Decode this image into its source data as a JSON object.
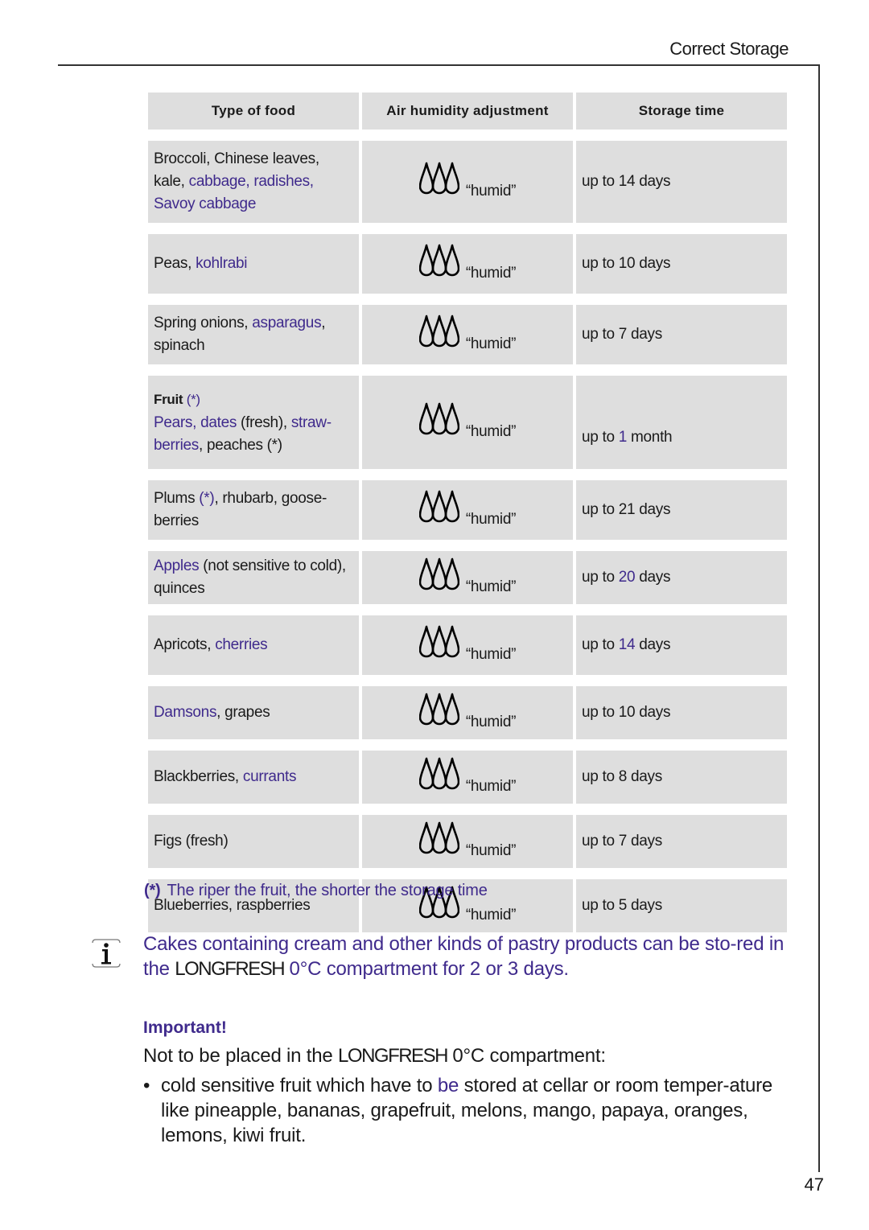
{
  "header": {
    "title": "Correct Storage"
  },
  "table": {
    "headers": [
      "Type of food",
      "Air humidity adjustment",
      "Storage time"
    ],
    "humidity_icon": "three-drops-icon",
    "rows": [
      {
        "food_parts": [
          {
            "text": "Broccoli, Chinese leaves,",
            "color": "black"
          },
          {
            "text": " kale, ",
            "color": "black"
          },
          {
            "text": "cabbage, radishes,",
            "color": "purple"
          },
          {
            "text": " Savoy cabbage",
            "color": "purple"
          }
        ],
        "humidity": "“humid”",
        "time_parts": [
          {
            "text": "up to 14 days",
            "color": "black"
          }
        ]
      },
      {
        "food_parts": [
          {
            "text": "Peas, ",
            "color": "black"
          },
          {
            "text": "kohlrabi",
            "color": "purple"
          }
        ],
        "humidity": "“humid”",
        "time_parts": [
          {
            "text": "up to 10 days",
            "color": "black"
          }
        ]
      },
      {
        "food_parts": [
          {
            "text": "Spring onions, ",
            "color": "black"
          },
          {
            "text": "asparagus",
            "color": "purple"
          },
          {
            "text": ", spinach",
            "color": "black"
          }
        ],
        "humidity": "“humid”",
        "time_parts": [
          {
            "text": "up to 7 days",
            "color": "black"
          }
        ]
      },
      {
        "title": "Fruit",
        "title_note": "(*)",
        "food_parts": [
          {
            "text": "Pears, dates",
            "color": "purple"
          },
          {
            "text": " (fresh), ",
            "color": "black"
          },
          {
            "text": "straw-berries",
            "color": "purple"
          },
          {
            "text": ", peaches (*)",
            "color": "black"
          }
        ],
        "humidity": "“humid”",
        "time_parts": [
          {
            "text": "up to ",
            "color": "black"
          },
          {
            "text": "1",
            "color": "purple"
          },
          {
            "text": " month",
            "color": "black"
          }
        ]
      },
      {
        "food_parts": [
          {
            "text": "Plums ",
            "color": "black"
          },
          {
            "text": "(*)",
            "color": "purple"
          },
          {
            "text": ", rhubarb, goose-berries",
            "color": "black"
          }
        ],
        "humidity": "“humid”",
        "time_parts": [
          {
            "text": "up to 21 days",
            "color": "black"
          }
        ]
      },
      {
        "food_parts": [
          {
            "text": "Apples",
            "color": "purple"
          },
          {
            "text": " (not sensitive to cold), quinces",
            "color": "black"
          }
        ],
        "humidity": "“humid”",
        "time_parts": [
          {
            "text": "up to ",
            "color": "black"
          },
          {
            "text": "20",
            "color": "purple"
          },
          {
            "text": " days",
            "color": "black"
          }
        ]
      },
      {
        "food_parts": [
          {
            "text": "Apricots, ",
            "color": "black"
          },
          {
            "text": "cherries",
            "color": "purple"
          }
        ],
        "humidity": "“humid”",
        "time_parts": [
          {
            "text": "up to ",
            "color": "black"
          },
          {
            "text": "14",
            "color": "purple"
          },
          {
            "text": " days",
            "color": "black"
          }
        ]
      },
      {
        "food_parts": [
          {
            "text": "Damsons",
            "color": "purple"
          },
          {
            "text": ", grapes",
            "color": "black"
          }
        ],
        "humidity": "“humid”",
        "time_parts": [
          {
            "text": "up to 10 days",
            "color": "black"
          }
        ]
      },
      {
        "food_parts": [
          {
            "text": "Blackberries, ",
            "color": "black"
          },
          {
            "text": "currants",
            "color": "purple"
          }
        ],
        "humidity": "“humid”",
        "time_parts": [
          {
            "text": "up to 8 days",
            "color": "black"
          }
        ]
      },
      {
        "food_parts": [
          {
            "text": "Figs (fresh)",
            "color": "black"
          }
        ],
        "humidity": "“humid”",
        "time_parts": [
          {
            "text": "up to 7 days",
            "color": "black"
          }
        ]
      },
      {
        "food_parts": [
          {
            "text": "Blueberries, raspberries",
            "color": "black"
          }
        ],
        "humidity": "“humid”",
        "time_parts": [
          {
            "text": "up to 5 days",
            "color": "black"
          }
        ]
      }
    ]
  },
  "footnote": {
    "marker": "(*)",
    "text": "The riper the fruit, the shorter the storage time"
  },
  "info_note": {
    "icon": "info-icon",
    "text_before": "Cakes containing cream and other kinds of pastry products can be sto-red in the ",
    "brand": "LONGFRESH",
    "text_after": " 0°C compartment for 2 or 3 days."
  },
  "important": {
    "heading": "Important!",
    "line_before": "Not to be placed in the ",
    "brand": "LONGFRESH",
    "line_after": " 0°C compartment:",
    "bullet": "•",
    "bullet_before": "cold sensitive fruit which have to ",
    "bullet_highlight": "be",
    "bullet_after": " stored at cellar or room temper-ature like pineapple, bananas, grapefruit, melons, mango, papaya, oranges, lemons, kiwi fruit."
  },
  "page_number": "47",
  "colors": {
    "accent_purple": "#3f2a8c",
    "cell_gray": "#dedede",
    "text_black": "#1a1a1a"
  }
}
